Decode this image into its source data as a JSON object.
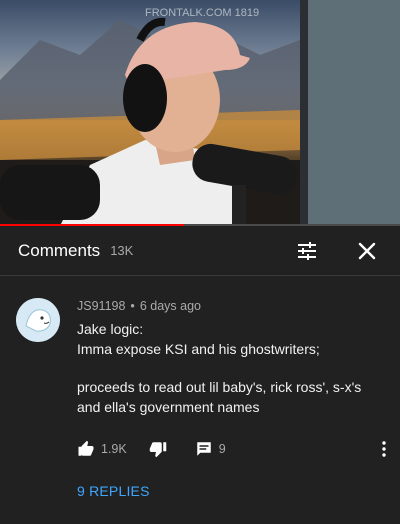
{
  "video": {
    "progress": 0.46,
    "watermark_text": "FRONTALK.COM 1819"
  },
  "comments_header": {
    "title": "Comments",
    "count": "13K"
  },
  "comment": {
    "author": "JS91198",
    "separator": "•",
    "time": "6 days ago",
    "lines": [
      "Jake logic:",
      "Imma expose KSI and his ghostwriters;",
      "",
      "proceeds to read out lil baby's, rick ross', s-x's",
      "and ella's government names"
    ],
    "likes": "1.9K",
    "reply_count": "9",
    "replies_label": "9 REPLIES"
  },
  "colors": {
    "background": "#212121",
    "link": "#3ea6ff",
    "muted": "#aaaaaa",
    "progress": "#ff0000"
  },
  "icons": {
    "filter": "tune-icon",
    "close": "close-icon",
    "like": "thumb-up-icon",
    "dislike": "thumb-down-icon",
    "reply": "reply-bubble-icon",
    "more": "more-vert-icon"
  }
}
